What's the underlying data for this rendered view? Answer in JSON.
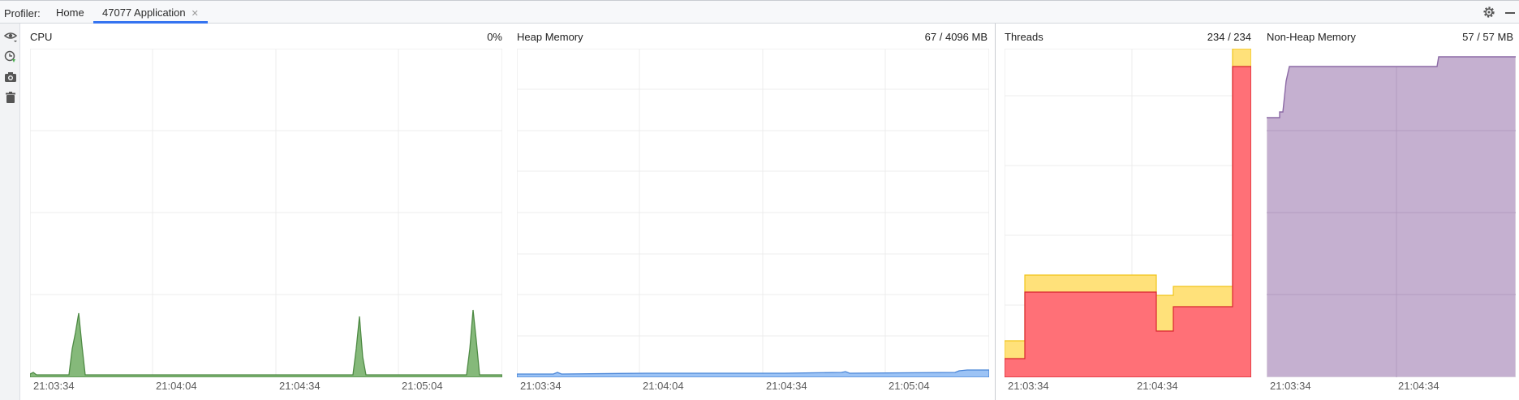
{
  "topbar": {
    "prefix": "Profiler:",
    "tabs": [
      {
        "label": "Home"
      },
      {
        "label": "47077 Application"
      }
    ]
  },
  "panels": {
    "cpu": {
      "title": "CPU",
      "value": "0%",
      "color_fill": "#85b97a",
      "color_line": "#4e8a44",
      "ticks": [
        "21:03:34",
        "21:04:04",
        "21:04:34",
        "21:05:04"
      ]
    },
    "heap": {
      "title": "Heap Memory",
      "value": "67 / 4096 MB",
      "color_fill": "#9cc3f5",
      "color_line": "#4a86d8",
      "ticks": [
        "21:03:34",
        "21:04:04",
        "21:04:34",
        "21:05:04"
      ]
    },
    "threads": {
      "title": "Threads",
      "value": "234 / 234",
      "color_total": "#ffe17a",
      "color_live": "#ff7077",
      "ticks": [
        "21:03:34",
        "21:04:34"
      ]
    },
    "nonheap": {
      "title": "Non-Heap Memory",
      "value": "57 / 57 MB",
      "color_fill": "#c5b0d0",
      "color_line": "#8c6aa5",
      "ticks": [
        "21:03:34",
        "21:04:34"
      ]
    }
  },
  "icons": {
    "sidebar": [
      "eye-icon",
      "gc-icon",
      "snapshot-icon",
      "trash-icon"
    ],
    "topbar": [
      "gear-icon",
      "minimize-icon"
    ]
  }
}
